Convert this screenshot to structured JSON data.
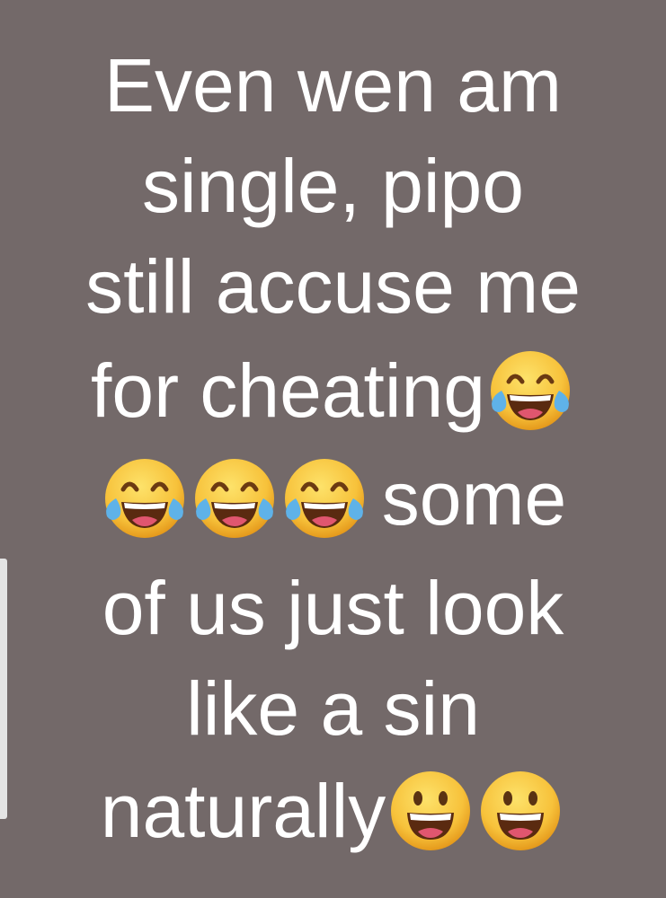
{
  "meme": {
    "lines": [
      "Even wen am",
      "single, pipo",
      "still accuse me",
      "for cheating",
      "some",
      "of us just look",
      "like a sin",
      "naturally"
    ],
    "emojis": {
      "laughing": "face-with-tears-of-joy-icon",
      "grinning": "grinning-face-icon"
    }
  },
  "colors": {
    "background": "#736969",
    "text": "#ffffff",
    "emoji_face": "#f7c23b",
    "tear": "#5fb2e8"
  }
}
